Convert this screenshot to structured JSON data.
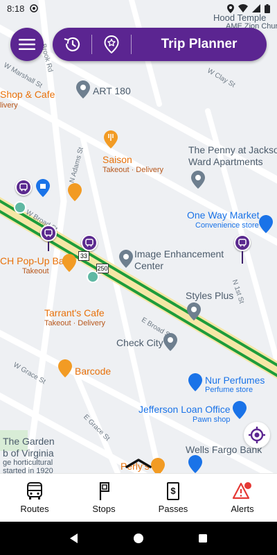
{
  "status_bar": {
    "time": "8:18"
  },
  "header": {
    "title": "Trip Planner"
  },
  "map": {
    "labels": {
      "top_right": "Hood Temple",
      "top_right2": "AME Zion Church",
      "art180": "ART 180",
      "shop_cafe": "Shop & Cafe",
      "shop_cafe_sub": "livery",
      "saison": "Saison",
      "saison_sub": "Takeout · Delivery",
      "penny": "The Penny at Jackson",
      "penny2": "Ward Apartments",
      "one_way": "One Way Market",
      "one_way_sub": "Convenience store",
      "image_center": "Image Enhancement",
      "image_center2": "Center",
      "popup_bar": "CH Pop-Up Bar",
      "popup_bar_sub": "Takeout",
      "tarrant": "Tarrant's Cafe",
      "tarrant_sub": "Takeout · Delivery",
      "styles_plus": "Styles Plus",
      "check_city": "Check City",
      "barcode": "Barcode",
      "nur": "Nur Perfumes",
      "nur_sub": "Perfume store",
      "jefferson": "Jefferson Loan Office",
      "jefferson_sub": "Pawn shop",
      "garden": "The Garden",
      "garden2": "b of Virginia",
      "garden3": "ge horticultural",
      "garden4": "started in 1920",
      "wells": "Wells Fargo Bank",
      "petty": "Perly's",
      "streets": {
        "brook": "Brook Rd",
        "marshall": "W Marshall St",
        "clay": "W Clay St",
        "adams": "N Adams St",
        "broad_w": "W Broad St",
        "broad_e": "E Broad St",
        "first": "N 1st St",
        "grace_w": "W Grace St",
        "grace_e": "E Grace St"
      },
      "route_33": "33",
      "route_250": "250"
    }
  },
  "bottom_nav": {
    "items": [
      {
        "label": "Routes",
        "icon": "bus-icon"
      },
      {
        "label": "Stops",
        "icon": "stop-sign-icon"
      },
      {
        "label": "Passes",
        "icon": "pass-icon"
      },
      {
        "label": "Alerts",
        "icon": "alert-icon"
      }
    ]
  },
  "colors": {
    "brand": "#5b2591",
    "alert": "#e53935",
    "route": "#1e9c3b"
  }
}
